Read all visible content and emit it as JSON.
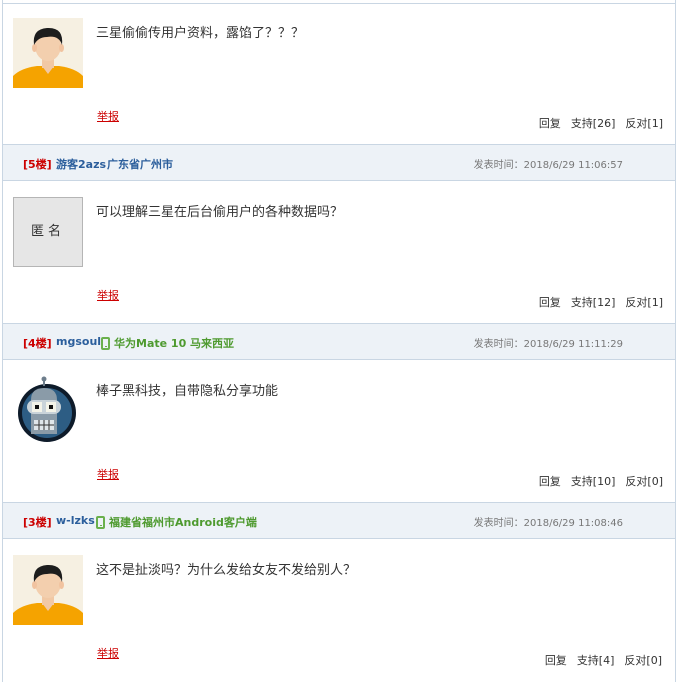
{
  "posts": [
    {
      "content": "三星偷偷传用户资料，露馅了？？？",
      "report": "举报",
      "reply": "回复",
      "support": "支持[26]",
      "oppose": "反对[1]",
      "avatar": "person-avatar"
    },
    {
      "floor": "[5楼]",
      "user": "游客2azs",
      "location": "广东省广州市",
      "time": "发表时间：2018/6/29 11:06:57",
      "anon_label": "匿名",
      "content": "可以理解三星在后台偷用户的各种数据吗？",
      "report": "举报",
      "reply": "回复",
      "support": "支持[12]",
      "oppose": "反对[1]",
      "avatar": "anonymous-avatar"
    },
    {
      "floor": "[4楼]",
      "user": "mgsoul",
      "location": "华为Mate 10 马来西亚",
      "time": "发表时间：2018/6/29 11:11:29",
      "content": "棒子黑科技，自带隐私分享功能",
      "report": "举报",
      "reply": "回复",
      "support": "支持[10]",
      "oppose": "反对[0]",
      "avatar": "robot-avatar",
      "device_icon": "phone-icon"
    },
    {
      "floor": "[3楼]",
      "user": "w-lzks",
      "location": "福建省福州市Android客户端",
      "time": "发表时间：2018/6/29 11:08:46",
      "content": "这不是扯淡吗？为什么发给女友不发给别人？",
      "report": "举报",
      "reply": "回复",
      "support": "支持[4]",
      "oppose": "反对[0]",
      "avatar": "person-avatar",
      "device_icon": "phone-icon"
    }
  ],
  "colors": {
    "header_bg": "#edf2f7",
    "border": "#c9d6e3",
    "floor": "#cc0000",
    "user": "#2b5e9c",
    "device_location": "#4e9a2f"
  }
}
